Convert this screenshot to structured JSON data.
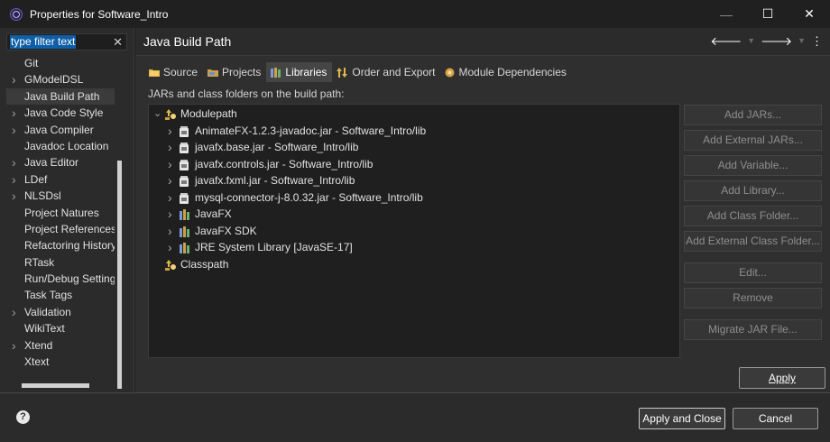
{
  "window": {
    "title": "Properties for Software_Intro",
    "minimize": "—",
    "maximize": "☐",
    "close": "✕"
  },
  "filter": {
    "value": "type filter text",
    "clear": "✕"
  },
  "left_tree": [
    {
      "label": "Git",
      "expandable": false
    },
    {
      "label": "GModelDSL",
      "expandable": true
    },
    {
      "label": "Java Build Path",
      "expandable": false,
      "selected": true
    },
    {
      "label": "Java Code Style",
      "expandable": true
    },
    {
      "label": "Java Compiler",
      "expandable": true
    },
    {
      "label": "Javadoc Location",
      "expandable": false
    },
    {
      "label": "Java Editor",
      "expandable": true
    },
    {
      "label": "LDef",
      "expandable": true
    },
    {
      "label": "NLSDsl",
      "expandable": true
    },
    {
      "label": "Project Natures",
      "expandable": false
    },
    {
      "label": "Project References",
      "expandable": false
    },
    {
      "label": "Refactoring History",
      "expandable": false
    },
    {
      "label": "RTask",
      "expandable": false
    },
    {
      "label": "Run/Debug Settings",
      "expandable": false
    },
    {
      "label": "Task Tags",
      "expandable": false
    },
    {
      "label": "Validation",
      "expandable": true
    },
    {
      "label": "WikiText",
      "expandable": false
    },
    {
      "label": "Xtend",
      "expandable": true
    },
    {
      "label": "Xtext",
      "expandable": false
    }
  ],
  "header": {
    "title": "Java Build Path"
  },
  "tabs": [
    {
      "label": "Source",
      "icon": "source-folder-icon"
    },
    {
      "label": "Projects",
      "icon": "projects-icon"
    },
    {
      "label": "Libraries",
      "icon": "libraries-icon",
      "active": true
    },
    {
      "label": "Order and Export",
      "icon": "order-icon"
    },
    {
      "label": "Module Dependencies",
      "icon": "module-icon"
    }
  ],
  "description": "JARs and class folders on the build path:",
  "build_path": {
    "modulepath": "Modulepath",
    "items": [
      {
        "label": "AnimateFX-1.2.3-javadoc.jar - Software_Intro/lib",
        "type": "jar"
      },
      {
        "label": "javafx.base.jar - Software_Intro/lib",
        "type": "jar"
      },
      {
        "label": "javafx.controls.jar - Software_Intro/lib",
        "type": "jar"
      },
      {
        "label": "javafx.fxml.jar - Software_Intro/lib",
        "type": "jar"
      },
      {
        "label": "mysql-connector-j-8.0.32.jar - Software_Intro/lib",
        "type": "jar"
      },
      {
        "label": "JavaFX",
        "type": "library"
      },
      {
        "label": "JavaFX SDK",
        "type": "library"
      },
      {
        "label": "JRE System Library [JavaSE-17]",
        "type": "library"
      }
    ],
    "classpath": "Classpath"
  },
  "buttons": {
    "add_jars": "Add JARs...",
    "add_external_jars": "Add External JARs...",
    "add_variable": "Add Variable...",
    "add_library": "Add Library...",
    "add_class_folder": "Add Class Folder...",
    "add_external_class_folder": "Add External Class Folder...",
    "edit": "Edit...",
    "remove": "Remove",
    "migrate_jar": "Migrate JAR File...",
    "apply": "Apply",
    "apply_and_close": "Apply and Close",
    "cancel": "Cancel",
    "help": "?"
  },
  "colors": {
    "accent": "#0e5fa8",
    "background": "#2f2f2f",
    "tree_bg": "#1f1f1f"
  }
}
